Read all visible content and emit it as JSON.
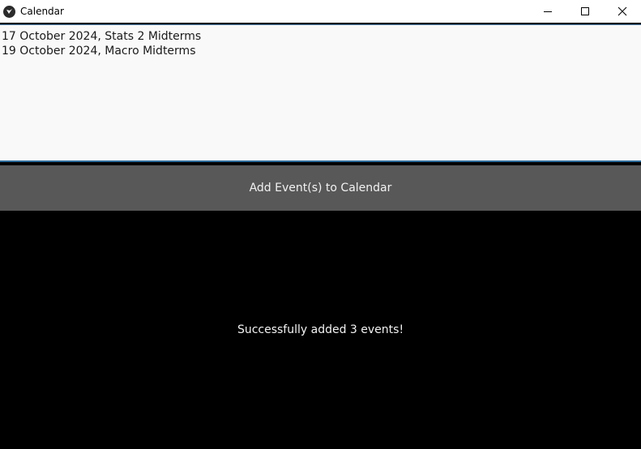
{
  "window": {
    "title": "Calendar",
    "icon": "kivy-logo-icon",
    "controls": {
      "minimize_icon": "minimize-icon",
      "maximize_icon": "maximize-icon",
      "close_icon": "close-icon"
    }
  },
  "events_input": {
    "lines": [
      "17 October 2024, Stats 2 Midterms",
      "19 October 2024, Macro Midterms"
    ]
  },
  "add_button": {
    "label": "Add Event(s) to Calendar"
  },
  "status": {
    "message": "Successfully added 3 events!"
  },
  "colors": {
    "input_background": "#f9f9f9",
    "button_background": "#585858",
    "status_background": "#000000",
    "text_light": "#f2f2f2",
    "focus_border": "#2e6b9a"
  }
}
